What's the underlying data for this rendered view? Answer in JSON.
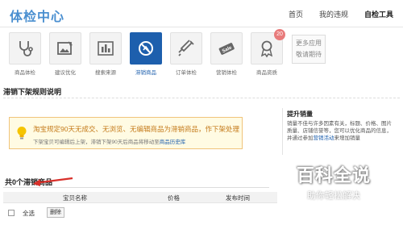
{
  "header": {
    "title": "体检中心",
    "nav": [
      "首页",
      "我的违规",
      "自检工具"
    ]
  },
  "tools": [
    {
      "label": "商品体检",
      "icon": "stethoscope-icon"
    },
    {
      "label": "建议优化",
      "icon": "image-edit-icon"
    },
    {
      "label": "搜索来源",
      "icon": "bar-chart-icon"
    },
    {
      "label": "滞销商品",
      "icon": "stalled-goods-icon",
      "selected": true
    },
    {
      "label": "订单体检",
      "icon": "syringe-icon"
    },
    {
      "label": "营销体检",
      "icon": "sale-tag-icon"
    },
    {
      "label": "商品资质",
      "icon": "award-ribbon-icon",
      "badge": "20"
    }
  ],
  "more_apps": {
    "line1": "更多应用",
    "line2": "敬请期待"
  },
  "rules": {
    "title": "滞销下架规则说明",
    "notice_main": "淘宝规定90天无成交、无浏览、无编辑商品为滞销商品，作下架处理",
    "notice_sub_prefix": "下架宝贝可编辑后上架，滞销下架90天后商品将移动至",
    "notice_sub_link": "商品历史库"
  },
  "tip": {
    "title": "提升销量",
    "text_prefix": "销量不佳与许多因素有关，标题、价格、图片质量、店铺信誉等，您可以优化商品的信息，并通过参加",
    "text_link": "营销活动",
    "text_suffix": "来增加销量"
  },
  "list": {
    "count_title": "共0个滞销商品",
    "columns": [
      "宝贝名称",
      "价格",
      "发布时间"
    ],
    "select_all": "全选",
    "delete": "删除"
  },
  "watermark": {
    "logo": "百科全说",
    "sub": "助你轻松解决"
  },
  "colors": {
    "brand": "#4a8fd0",
    "selected_tool": "#1d5fad",
    "notice_bg": "#fffbe3",
    "notice_text": "#c47a1a",
    "badge": "#e87b7b",
    "arrow": "#d8302a"
  }
}
